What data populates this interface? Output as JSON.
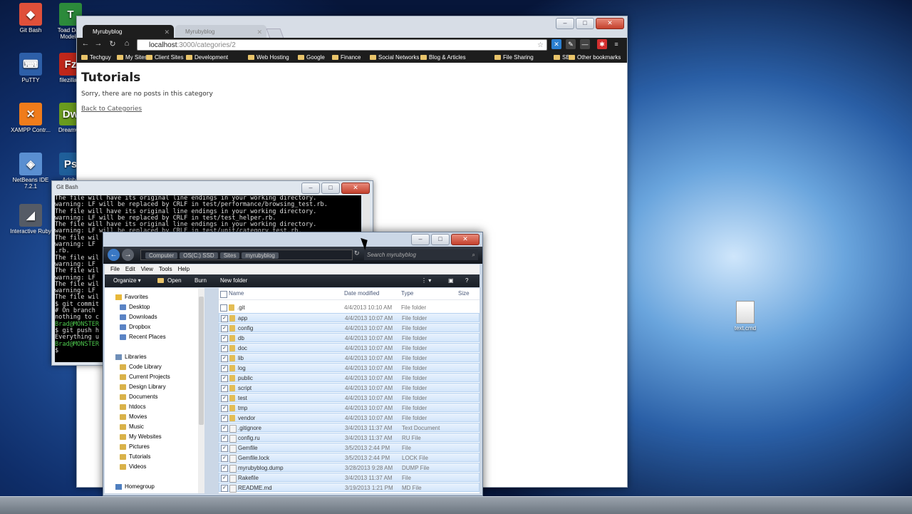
{
  "desktop": {
    "icons": [
      {
        "label": "Git Bash",
        "glyph": "◆",
        "color": "#e0503a"
      },
      {
        "label": "Toad Data Modeler",
        "glyph": "T",
        "color": "#2c8a3b"
      },
      {
        "label": "PuTTY",
        "glyph": "⌨",
        "color": "#2d5fa8"
      },
      {
        "label": "filezilla.e",
        "glyph": "Fz",
        "color": "#c0271b"
      },
      {
        "label": "XAMPP Contr...",
        "glyph": "✕",
        "color": "#f07c1b"
      },
      {
        "label": "Dreamwe",
        "glyph": "Dw",
        "color": "#6a9b1e"
      },
      {
        "label": "NetBeans IDE 7.2.1",
        "glyph": "◈",
        "color": "#5a8fd1"
      },
      {
        "label": "Adobe",
        "glyph": "Ps",
        "color": "#1f5f9a"
      },
      {
        "label": "Interactive Ruby",
        "glyph": "◢",
        "color": "#555b66"
      }
    ],
    "file": {
      "label": "text.cmd"
    }
  },
  "chrome": {
    "tabs": [
      {
        "label": "Myrubyblog",
        "active": true
      },
      {
        "label": "Myrubyblog",
        "active": false
      }
    ],
    "url_host": "localhost",
    "url_rest": ":3000/categories/2",
    "bookmarks": [
      "Techguy",
      "My Sites",
      "Client Sites",
      "Development",
      "Web Hosting",
      "Google",
      "Finance",
      "Social Networks",
      "Blog & Articles",
      "File Sharing",
      "SEO",
      "Other bookmarks"
    ],
    "page": {
      "heading": "Tutorials",
      "message": "Sorry, there are no posts in this category",
      "back_link": "Back to Categories"
    }
  },
  "gitbash": {
    "title": "Git Bash",
    "lines": [
      {
        "text": "The file will have its original line endings in your working directory.",
        "green": false
      },
      {
        "text": "warning: LF will be replaced by CRLF in test/performance/browsing_test.rb.",
        "green": false
      },
      {
        "text": "The file will have its original line endings in your working directory.",
        "green": false
      },
      {
        "text": "warning: LF will be replaced by CRLF in test/test_helper.rb.",
        "green": false
      },
      {
        "text": "The file will have its original line endings in your working directory.",
        "green": false
      },
      {
        "text": "warning: LF will be replaced by CRLF in test/unit/category_test.rb.",
        "green": false
      },
      {
        "text": "The file wil",
        "green": false
      },
      {
        "text": "warning: LF",
        "green": false
      },
      {
        "text": ".rb.",
        "green": false
      },
      {
        "text": "The file wil",
        "green": false
      },
      {
        "text": "warning: LF",
        "green": false
      },
      {
        "text": "The file wil",
        "green": false
      },
      {
        "text": "warning: LF",
        "green": false
      },
      {
        "text": "The file wil",
        "green": false
      },
      {
        "text": "warning: LF",
        "green": false
      },
      {
        "text": "The file wil",
        "green": false
      },
      {
        "text": "$ git commit",
        "green": false
      },
      {
        "text": "# On branch",
        "green": false
      },
      {
        "text": "nothing to c",
        "green": false
      },
      {
        "text": "Brad@MONSTER",
        "green": true
      },
      {
        "text": "$ git push h",
        "green": false
      },
      {
        "text": "Everything u",
        "green": false
      },
      {
        "text": "Brad@MONSTER",
        "green": true
      },
      {
        "text": "$",
        "green": false
      }
    ]
  },
  "explorer": {
    "breadcrumb": [
      "Computer",
      "OS(C:) SSD",
      "Sites",
      "myrubyblog"
    ],
    "search_placeholder": "Search myrubyblog",
    "menu": [
      "File",
      "Edit",
      "View",
      "Tools",
      "Help"
    ],
    "commands": [
      "Organize ▾",
      "Open",
      "Burn",
      "New folder"
    ],
    "nav": {
      "favorites_label": "Favorites",
      "favorites": [
        "Desktop",
        "Downloads",
        "Dropbox",
        "Recent Places"
      ],
      "libraries_label": "Libraries",
      "libraries": [
        "Code Library",
        "Current Projects",
        "Design Library",
        "Documents",
        "htdocs",
        "Movies",
        "Music",
        "My Websites",
        "Pictures",
        "Tutorials",
        "Videos"
      ],
      "homegroup_label": "Homegroup"
    },
    "columns": {
      "name": "Name",
      "date": "Date modified",
      "type": "Type",
      "size": "Size"
    },
    "files": [
      {
        "name": ".git",
        "date": "4/4/2013 10:10 AM",
        "type": "File folder",
        "kind": "folder",
        "checked": false
      },
      {
        "name": "app",
        "date": "4/4/2013 10:07 AM",
        "type": "File folder",
        "kind": "folder",
        "checked": true
      },
      {
        "name": "config",
        "date": "4/4/2013 10:07 AM",
        "type": "File folder",
        "kind": "folder",
        "checked": true
      },
      {
        "name": "db",
        "date": "4/4/2013 10:07 AM",
        "type": "File folder",
        "kind": "folder",
        "checked": true
      },
      {
        "name": "doc",
        "date": "4/4/2013 10:07 AM",
        "type": "File folder",
        "kind": "folder",
        "checked": true
      },
      {
        "name": "lib",
        "date": "4/4/2013 10:07 AM",
        "type": "File folder",
        "kind": "folder",
        "checked": true
      },
      {
        "name": "log",
        "date": "4/4/2013 10:07 AM",
        "type": "File folder",
        "kind": "folder",
        "checked": true
      },
      {
        "name": "public",
        "date": "4/4/2013 10:07 AM",
        "type": "File folder",
        "kind": "folder",
        "checked": true
      },
      {
        "name": "script",
        "date": "4/4/2013 10:07 AM",
        "type": "File folder",
        "kind": "folder",
        "checked": true
      },
      {
        "name": "test",
        "date": "4/4/2013 10:07 AM",
        "type": "File folder",
        "kind": "folder",
        "checked": true
      },
      {
        "name": "tmp",
        "date": "4/4/2013 10:07 AM",
        "type": "File folder",
        "kind": "folder",
        "checked": true
      },
      {
        "name": "vendor",
        "date": "4/4/2013 10:07 AM",
        "type": "File folder",
        "kind": "folder",
        "checked": true
      },
      {
        "name": ".gitignore",
        "date": "3/4/2013 11:37 AM",
        "type": "Text Document",
        "kind": "file",
        "checked": true
      },
      {
        "name": "config.ru",
        "date": "3/4/2013 11:37 AM",
        "type": "RU File",
        "kind": "file",
        "checked": true
      },
      {
        "name": "Gemfile",
        "date": "3/5/2013 2:44 PM",
        "type": "File",
        "kind": "file",
        "checked": true
      },
      {
        "name": "Gemfile.lock",
        "date": "3/5/2013 2:44 PM",
        "type": "LOCK File",
        "kind": "file",
        "checked": true
      },
      {
        "name": "myrubyblog.dump",
        "date": "3/28/2013 9:28 AM",
        "type": "DUMP File",
        "kind": "file",
        "checked": true
      },
      {
        "name": "Rakefile",
        "date": "3/4/2013 11:37 AM",
        "type": "File",
        "kind": "file",
        "checked": true
      },
      {
        "name": "README.md",
        "date": "3/19/2013 1:21 PM",
        "type": "MD File",
        "kind": "file",
        "checked": true
      }
    ]
  }
}
